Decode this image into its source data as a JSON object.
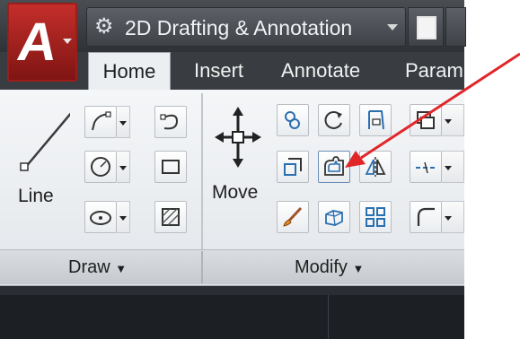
{
  "workspace": {
    "label": "2D Drafting & Annotation"
  },
  "tabs": [
    {
      "label": "Home",
      "active": true
    },
    {
      "label": "Insert"
    },
    {
      "label": "Annotate"
    },
    {
      "label": "Param"
    }
  ],
  "draw_panel": {
    "title": "Draw",
    "line_label": "Line"
  },
  "modify_panel": {
    "title": "Modify",
    "move_label": "Move"
  },
  "colors": {
    "annotation_arrow": "#e1262a",
    "app_button": "#c62f2b"
  }
}
